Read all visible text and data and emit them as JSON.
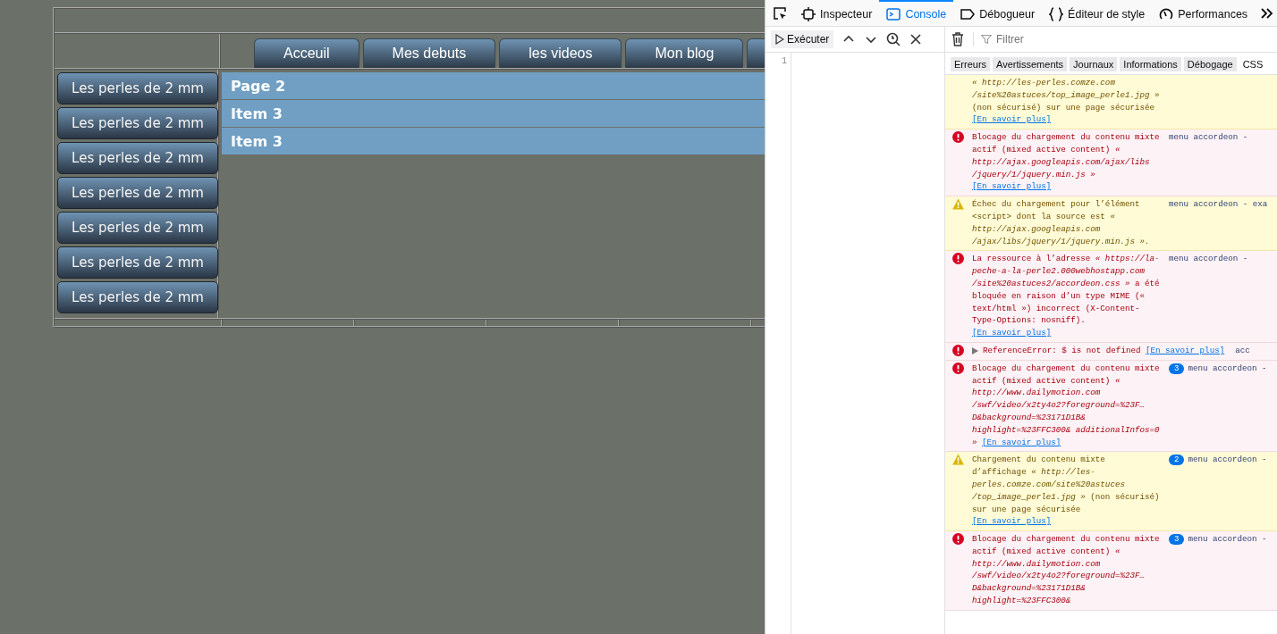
{
  "page": {
    "nav_tabs": [
      {
        "label": "Acceuil"
      },
      {
        "label": "Mes debuts"
      },
      {
        "label": "les videos"
      },
      {
        "label": "Mon blog"
      }
    ],
    "side_buttons": [
      "Les perles de 2 mm",
      "Les perles de 2 mm",
      "Les perles de 2 mm",
      "Les perles de 2 mm",
      "Les perles de 2 mm",
      "Les perles de 2 mm",
      "Les perles de 2 mm"
    ],
    "accordion": [
      "Page 2",
      "Item 3",
      "Item 3"
    ]
  },
  "devtools": {
    "tabs": [
      {
        "label": "Inspecteur",
        "selected": false
      },
      {
        "label": "Console",
        "selected": true
      },
      {
        "label": "Débogueur",
        "selected": false
      },
      {
        "label": "Éditeur de style",
        "selected": false
      },
      {
        "label": "Performances",
        "selected": false
      }
    ],
    "run_button": "Exécuter",
    "line_number": "1",
    "filter": {
      "placeholder": "Filtrer"
    },
    "filter_buttons": [
      {
        "label": "Erreurs",
        "selected": true
      },
      {
        "label": "Avertissements",
        "selected": true
      },
      {
        "label": "Journaux",
        "selected": true
      },
      {
        "label": "Informations",
        "selected": true
      },
      {
        "label": "Débogage",
        "selected": true
      },
      {
        "label": "CSS",
        "selected": false
      }
    ],
    "messages": [
      {
        "kind": "continuation",
        "text": "*« http://les-perles.comze.com /site%20astuces/top_image_perle1.jpg »* (non sécurisé) sur une page sécurisée",
        "link": "[En savoir plus]"
      },
      {
        "kind": "error",
        "text": "Blocage du chargement du contenu mixte actif (mixed active content) *« http://ajax.googleapis.com/ajax/libs /jquery/1/jquery.min.js »*",
        "link": "[En savoir plus]",
        "source": "menu accordeon -"
      },
      {
        "kind": "warning",
        "text": "Échec du chargement pour l’élément <script> dont la source est *« http://ajax.googleapis.com /ajax/libs/jquery/1/jquery.min.js ».*",
        "source": "menu accordeon - exa"
      },
      {
        "kind": "error",
        "text": "La ressource à l’adresse *« https://la-peche-a-la-perle2.000webhostapp.com /site%20astuces2/accordeon.css »* a été bloquée en raison d’un type MIME (« text/html ») incorrect (X-Content-Type-Options: nosniff).",
        "link": "[En savoir plus]",
        "source": "menu accordeon -"
      },
      {
        "kind": "exception",
        "text": "ReferenceError: $ is not defined",
        "link": "[En savoir plus]",
        "source": "acc"
      },
      {
        "kind": "error",
        "text": "Blocage du chargement du contenu mixte actif (mixed active content) *« http://www.dailymotion.com /swf/video/x2ty4o2?foreground=%23F… D&background=%23171D1B& highlight=%23FFC300& additionalInfos=0 »*",
        "link": "[En savoir plus]",
        "count": "3",
        "source": "menu accordeon -"
      },
      {
        "kind": "warning",
        "text": "Chargement du contenu mixte d’affichage *« http://les-perles.comze.com/site%20astuces /top_image_perle1.jpg »* (non sécurisé) sur une page sécurisée",
        "link": "[En savoir plus]",
        "count": "2",
        "source": "menu accordeon -"
      },
      {
        "kind": "error",
        "text": "Blocage du chargement du contenu mixte actif (mixed active content) *« http://www.dailymotion.com /swf/video/x2ty4o2?foreground=%23F… D&background=%23171D1B& highlight=%23FFC300&*",
        "count": "3",
        "source": "menu accordeon -"
      }
    ]
  }
}
